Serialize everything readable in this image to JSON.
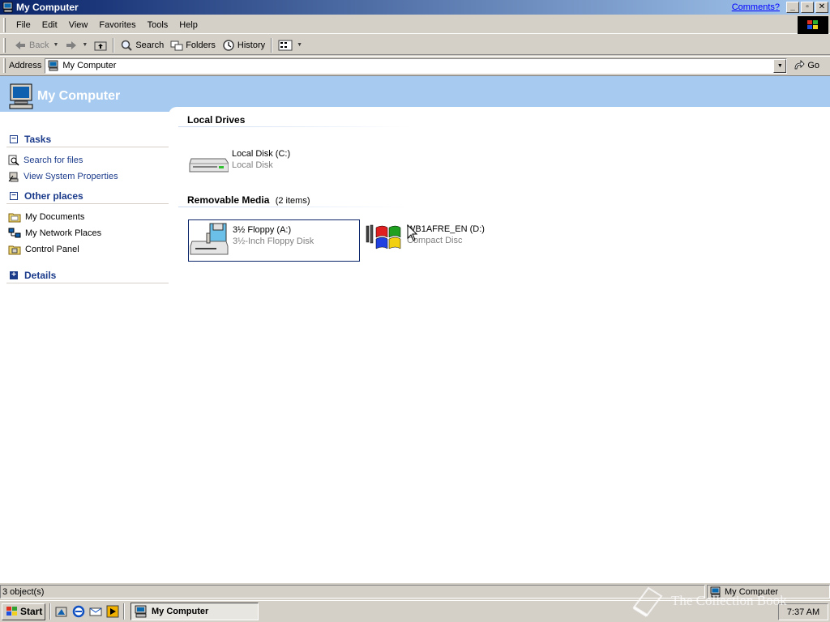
{
  "window": {
    "title": "My Computer",
    "comments_link": "Comments?",
    "minimize": "_",
    "maximize": "▫",
    "close": "✕"
  },
  "menu": [
    "File",
    "Edit",
    "View",
    "Favorites",
    "Tools",
    "Help"
  ],
  "toolbar": {
    "back": "Back",
    "search": "Search",
    "folders": "Folders",
    "history": "History"
  },
  "address": {
    "label": "Address",
    "value": "My Computer",
    "go": "Go"
  },
  "banner": {
    "title": "My Computer"
  },
  "left_panel": {
    "tasks": {
      "title": "Tasks",
      "toggle": "−",
      "items": [
        "Search for files",
        "View System Properties"
      ]
    },
    "other_places": {
      "title": "Other places",
      "toggle": "−",
      "items": [
        "My Documents",
        "My Network Places",
        "Control Panel"
      ]
    },
    "details": {
      "title": "Details",
      "toggle": "+"
    }
  },
  "groups": {
    "local": {
      "title": "Local Drives",
      "items": [
        {
          "name": "Local Disk (C:)",
          "type": "Local Disk"
        }
      ]
    },
    "removable": {
      "title": "Removable Media",
      "count": "(2 items)",
      "items": [
        {
          "name": "3½ Floppy (A:)",
          "type": "3½-Inch Floppy Disk"
        },
        {
          "name": "WB1AFRE_EN (D:)",
          "type": "Compact Disc"
        }
      ]
    }
  },
  "statusbar": {
    "objects": "3 object(s)",
    "zone": "My Computer"
  },
  "taskbar": {
    "start": "Start",
    "task": "My Computer",
    "clock": "7:37 AM"
  },
  "watermark": "The Collection Book"
}
